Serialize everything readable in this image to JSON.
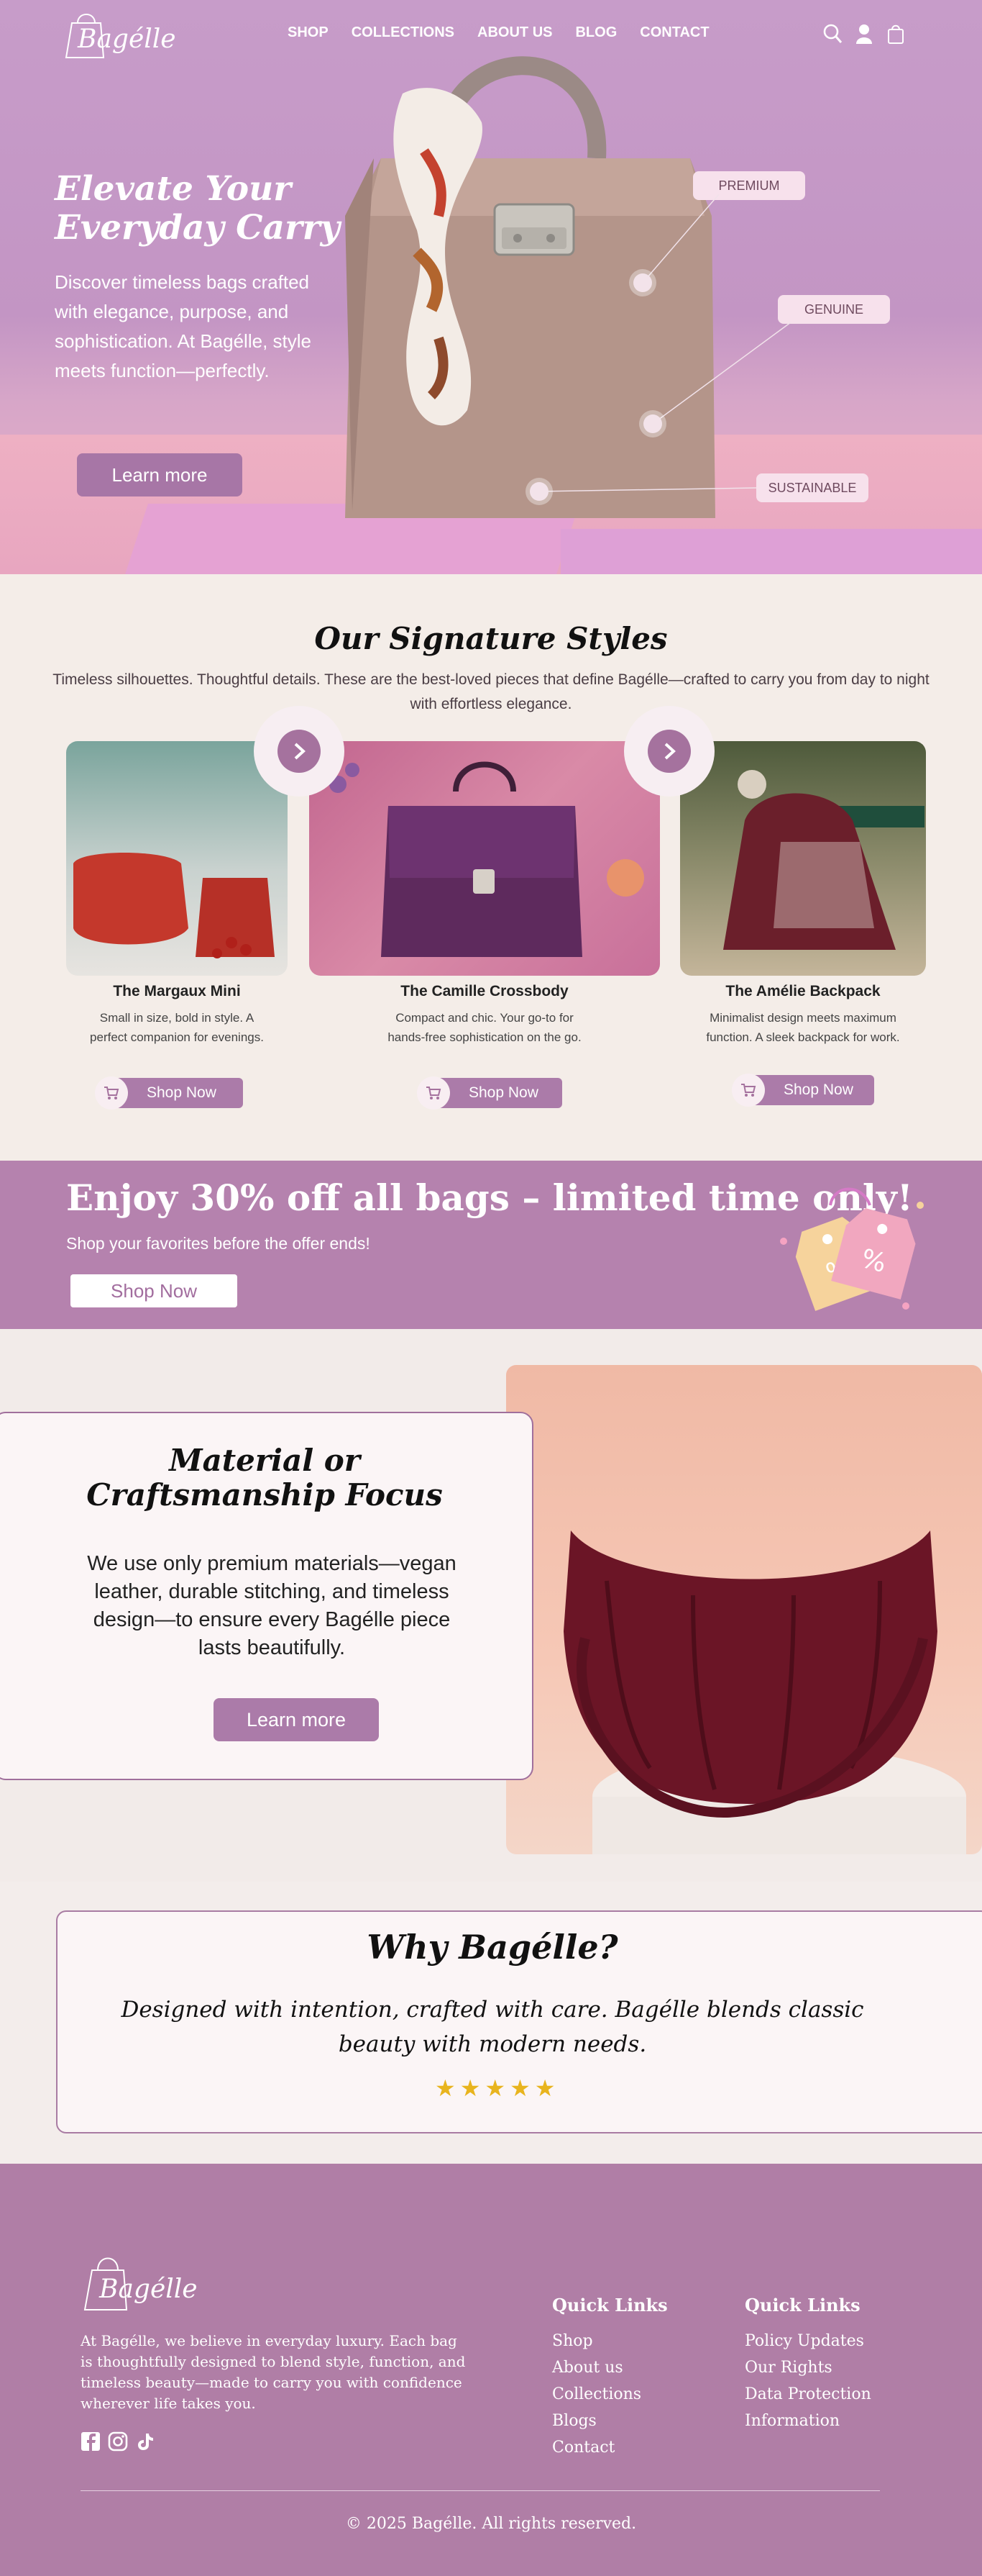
{
  "brand": {
    "name": "Bagélle"
  },
  "nav": {
    "links": [
      "SHOP",
      "COLLECTIONS",
      "ABOUT US",
      "BLOG",
      "CONTACT"
    ],
    "icons": [
      "search-icon",
      "user-icon",
      "bag-icon"
    ]
  },
  "hero": {
    "title_line1": "Elevate Your",
    "title_line2": "Everyday Carry",
    "text": "Discover timeless bags crafted with elegance, purpose, and sophistication. At Bagélle, style meets function—perfectly.",
    "cta": "Learn more",
    "tags": [
      "PREMIUM",
      "GENUINE",
      "SUSTAINABLE"
    ]
  },
  "signature": {
    "title": "Our Signature Styles",
    "subtitle": "Timeless silhouettes. Thoughtful details. These are the best-loved pieces that define Bagélle—crafted to carry you from day to night with effortless elegance.",
    "products": [
      {
        "name": "The Margaux Mini",
        "desc_line1": "Small in size, bold in style. A",
        "desc_line2": "perfect companion for evenings.",
        "cta": "Shop Now"
      },
      {
        "name": "The Camille Crossbody",
        "desc_line1": "Compact and chic. Your go-to for",
        "desc_line2": "hands-free sophistication on the go.",
        "cta": "Shop Now"
      },
      {
        "name": "The Amélie Backpack",
        "desc_line1": "Minimalist design meets maximum",
        "desc_line2": "function. A sleek backpack for work.",
        "cta": "Shop Now"
      }
    ]
  },
  "promo": {
    "title": "Enjoy 30% off all bags – limited time only!",
    "subtitle": "Shop your favorites before the offer ends!",
    "cta": "Shop Now"
  },
  "material": {
    "title_line1": "Material or",
    "title_line2": "Craftsmanship Focus",
    "text": "We use only premium materials—vegan leather, durable stitching, and timeless design—to ensure every Bagélle piece lasts beautifully.",
    "cta": "Learn more"
  },
  "why": {
    "title": "Why Bagélle?",
    "text": "Designed with intention, crafted with care. Bagélle blends classic beauty with modern needs.",
    "rating_stars": 5
  },
  "footer": {
    "about": "At Bagélle, we believe in everyday luxury. Each bag is thoughtfully designed to blend style, function, and timeless beauty—made to carry you with confidence wherever life takes you.",
    "social": [
      "facebook-icon",
      "instagram-icon",
      "tiktok-icon"
    ],
    "col1_title": "Quick Links",
    "col1_links": [
      "Shop",
      "About us",
      "Collections",
      "Blogs",
      "Contact"
    ],
    "col2_title": "Quick Links",
    "col2_links": [
      "Policy Updates",
      "Our Rights",
      "Data Protection",
      "Information"
    ],
    "copyright": "© 2025 Bagélle. All rights reserved."
  },
  "colors": {
    "accent": "#b07ea6",
    "hero_bg": "#c79cc9",
    "button": "#ab7ba9",
    "star": "#e8b41e"
  }
}
